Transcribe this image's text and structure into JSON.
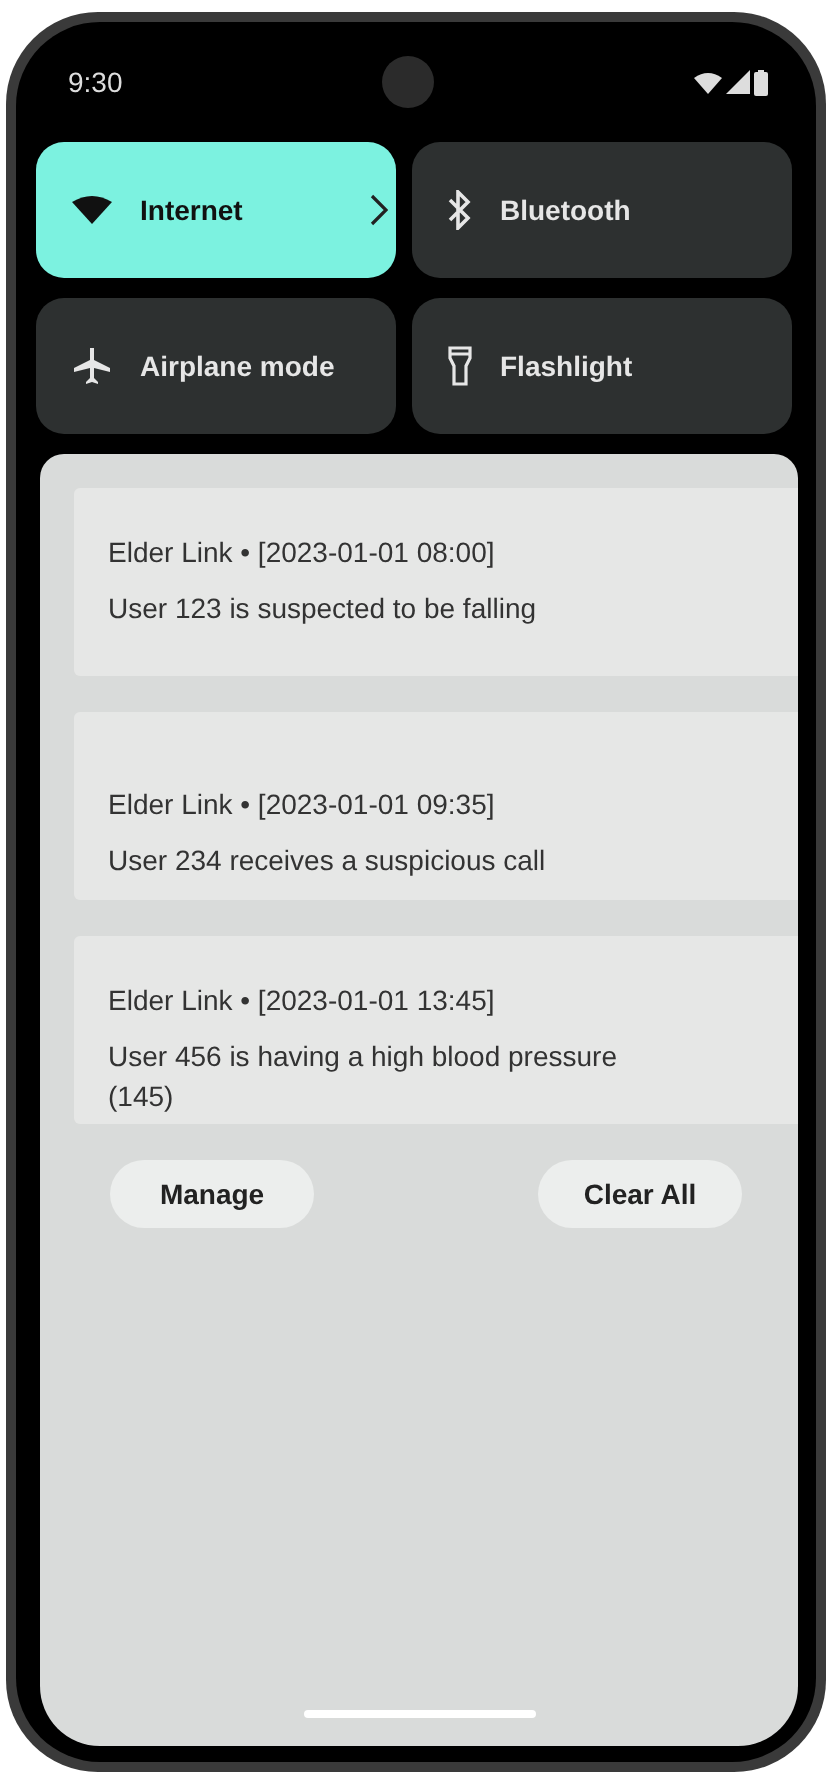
{
  "status_bar": {
    "time": "9:30"
  },
  "tiles": [
    {
      "label": "Internet",
      "kind": "expandable",
      "on": true
    },
    {
      "label": "Bluetooth",
      "kind": "toggle",
      "on": false
    },
    {
      "label": "Airplane mode",
      "kind": "toggle",
      "on": false
    },
    {
      "label": "Flashlight",
      "kind": "toggle",
      "on": false
    }
  ],
  "notifications": [
    {
      "header": "Elder Link • [2023-01-01 08:00]",
      "message": "User 123 is suspected to be falling"
    },
    {
      "header": "Elder Link • [2023-01-01 09:35]",
      "message": "User 234 receives a suspicious call"
    },
    {
      "header": "Elder Link • [2023-01-01 13:45]",
      "message": "User 456 is having a high blood pressure (145)"
    }
  ],
  "buttons": [
    "Manage",
    "Clear All"
  ]
}
